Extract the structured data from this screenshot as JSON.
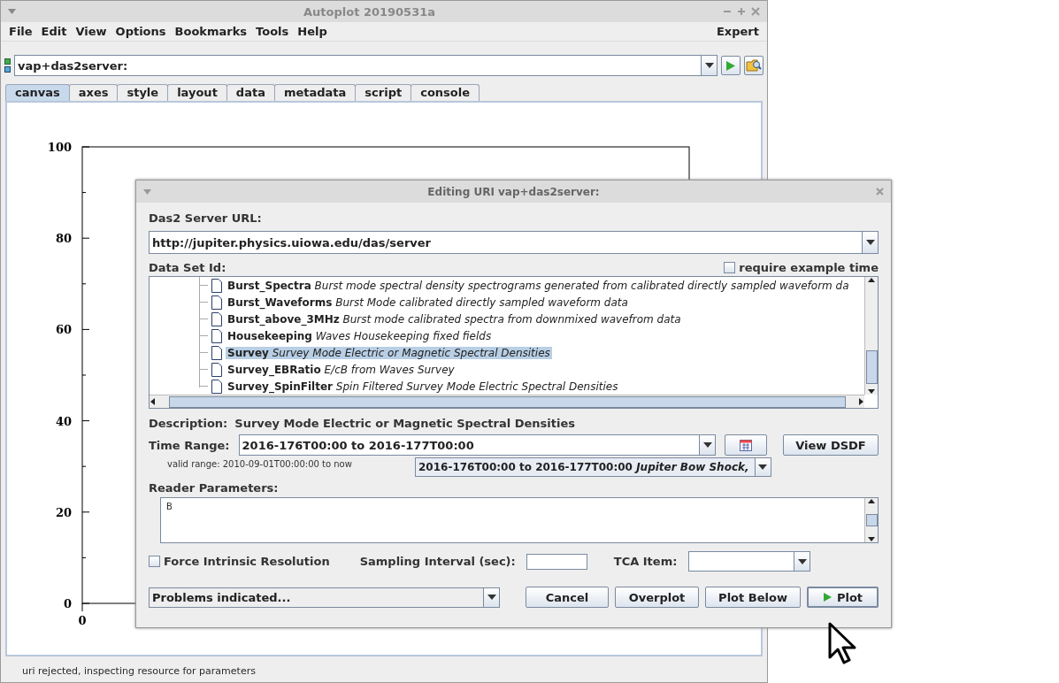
{
  "window": {
    "title": "Autoplot 20190531a"
  },
  "menu": [
    "File",
    "Edit",
    "View",
    "Options",
    "Bookmarks",
    "Tools",
    "Help"
  ],
  "menu_right": "Expert",
  "uri_field": {
    "value": "vap+das2server:"
  },
  "tabs": [
    {
      "label": "canvas",
      "selected": true
    },
    {
      "label": "axes",
      "selected": false
    },
    {
      "label": "style",
      "selected": false
    },
    {
      "label": "layout",
      "selected": false
    },
    {
      "label": "data",
      "selected": false
    },
    {
      "label": "metadata",
      "selected": false
    },
    {
      "label": "script",
      "selected": false
    },
    {
      "label": "console",
      "selected": false
    }
  ],
  "plot": {
    "y_tick_labels": [
      "100",
      "80",
      "60",
      "40",
      "20",
      "0"
    ],
    "x_tick_labels": [
      "0"
    ]
  },
  "status_bar": "uri rejected, inspecting resource for parameters",
  "dialog": {
    "title": "Editing URI vap+das2server:",
    "server_label": "Das2 Server URL:",
    "server_url": "http://jupiter.physics.uiowa.edu/das/server",
    "dataset_label": "Data Set Id:",
    "require_example_time": {
      "label": "require example time",
      "checked": false
    },
    "datasets": [
      {
        "name": "Burst_Spectra",
        "description": "Burst mode spectral density spectrograms generated from calibrated directly sampled waveform da",
        "selected": false
      },
      {
        "name": "Burst_Waveforms",
        "description": "Burst Mode calibrated directly sampled waveform data",
        "selected": false
      },
      {
        "name": "Burst_above_3MHz",
        "description": "Burst mode calibrated spectra from downmixed wavefrom data",
        "selected": false
      },
      {
        "name": "Housekeeping",
        "description": "Waves Housekeeping fixed fields",
        "selected": false
      },
      {
        "name": "Survey",
        "description": "Survey Mode Electric or Magnetic Spectral Densities",
        "selected": true
      },
      {
        "name": "Survey_EBRatio",
        "description": "E/cB from Waves Survey",
        "selected": false
      },
      {
        "name": "Survey_SpinFilter",
        "description": "Spin Filtered Survey Mode Electric Spectral Densities",
        "selected": false
      }
    ],
    "description_label": "Description:",
    "description": "Survey Mode Electric or Magnetic Spectral Densities",
    "time_range_label": "Time Range:",
    "time_range": "2016-176T00:00 to 2016-177T00:00",
    "view_dsdf": "View DSDF",
    "valid_range": "valid range: 2010-09-01T00:00:00 to now",
    "example_time": {
      "range": "2016-176T00:00 to 2016-177T00:00",
      "name": "Jupiter Bow Shock,"
    },
    "reader_parameters_label": "Reader Parameters:",
    "reader_parameters": "B",
    "force_intrinsic": {
      "label": "Force Intrinsic Resolution",
      "checked": false
    },
    "sampling_label": "Sampling Interval (sec):",
    "tca_label": "TCA Item:",
    "problems": "Problems indicated...",
    "buttons": [
      {
        "label": "Cancel",
        "kind": "plain"
      },
      {
        "label": "Overplot",
        "kind": "plain"
      },
      {
        "label": "Plot Below",
        "kind": "plain"
      },
      {
        "label": "Plot",
        "kind": "play"
      }
    ]
  }
}
